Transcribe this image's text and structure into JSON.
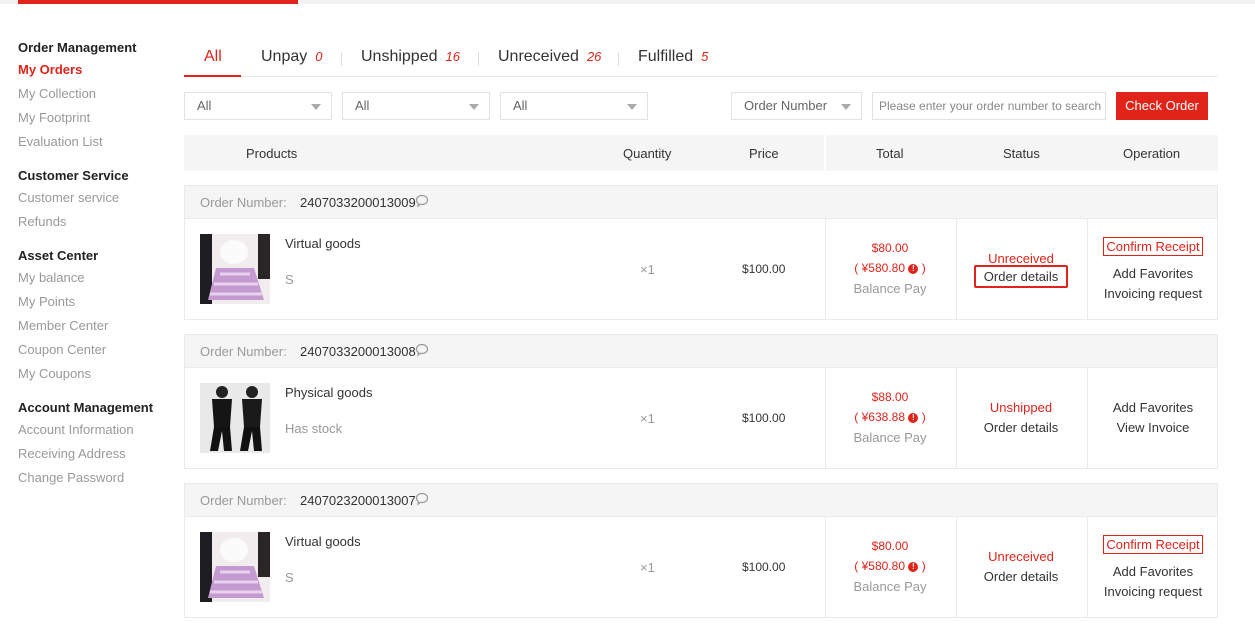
{
  "sidebar": {
    "groups": [
      {
        "title": "Order Management",
        "items": [
          "My Orders",
          "My Collection",
          "My Footprint",
          "Evaluation List"
        ]
      },
      {
        "title": "Customer Service",
        "items": [
          "Customer service",
          "Refunds"
        ]
      },
      {
        "title": "Asset Center",
        "items": [
          "My balance",
          "My Points",
          "Member Center",
          "Coupon Center",
          "My Coupons"
        ]
      },
      {
        "title": "Account Management",
        "items": [
          "Account Information",
          "Receiving Address",
          "Change Password"
        ]
      }
    ]
  },
  "tabs": [
    {
      "label": "All",
      "count": ""
    },
    {
      "label": "Unpay",
      "count": "0"
    },
    {
      "label": "Unshipped",
      "count": "16"
    },
    {
      "label": "Unreceived",
      "count": "26"
    },
    {
      "label": "Fulfilled",
      "count": "5"
    }
  ],
  "filters": {
    "select1": "All",
    "select2": "All",
    "select3": "All",
    "search_type": "Order Number",
    "search_placeholder": "Please enter your order number to search",
    "check_button": "Check Order"
  },
  "columns": [
    "Products",
    "Quantity",
    "Price",
    "Total",
    "Status",
    "Operation"
  ],
  "order_label": "Order Number:",
  "orders": [
    {
      "number": "2407033200013009",
      "name": "Virtual goods",
      "spec": "S",
      "qty": "×1",
      "price": "$100.00",
      "total": "$80.00",
      "total_cny": "( ¥580.80",
      "total_close": ")",
      "pay": "Balance Pay",
      "status": "Unreceived",
      "details": "Order details",
      "ops": [
        "Confirm Receipt",
        "Add Favorites",
        "Invoicing request"
      ]
    },
    {
      "number": "2407033200013008",
      "name": "Physical goods",
      "spec": "Has stock",
      "qty": "×1",
      "price": "$100.00",
      "total": "$88.00",
      "total_cny": "( ¥638.88",
      "total_close": ")",
      "pay": "Balance Pay",
      "status": "Unshipped",
      "details": "Order details",
      "ops": [
        "Add Favorites",
        "View Invoice"
      ]
    },
    {
      "number": "2407023200013007",
      "name": "Virtual goods",
      "spec": "S",
      "qty": "×1",
      "price": "$100.00",
      "total": "$80.00",
      "total_cny": "( ¥580.80",
      "total_close": ")",
      "pay": "Balance Pay",
      "status": "Unreceived",
      "details": "Order details",
      "ops": [
        "Confirm Receipt",
        "Add Favorites",
        "Invoicing request"
      ]
    }
  ],
  "colors": {
    "accent": "#e0241a"
  }
}
